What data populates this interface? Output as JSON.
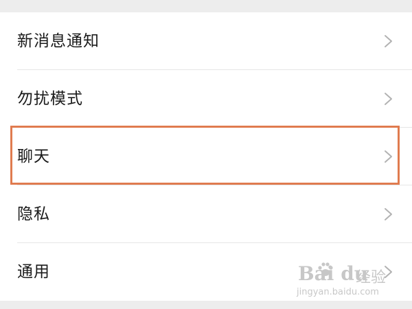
{
  "settings_list": {
    "items": [
      {
        "label": "新消息通知"
      },
      {
        "label": "勿扰模式"
      },
      {
        "label": "聊天"
      },
      {
        "label": "隐私"
      },
      {
        "label": "通用"
      }
    ],
    "highlighted_item": "聊天",
    "highlight_color": "#e07b4f",
    "chevron_icon": "chevron-right-icon"
  },
  "watermark": {
    "brand": "Bai du",
    "brand_sub": "经验",
    "url": "jingyan.baidu.com"
  }
}
